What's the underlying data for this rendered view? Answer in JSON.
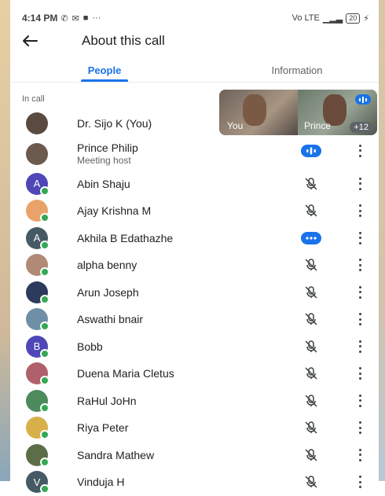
{
  "status_bar": {
    "time": "4:14 PM",
    "overflow": "···",
    "network": "Vo LTE",
    "battery": "20"
  },
  "app_bar": {
    "title": "About this call"
  },
  "tabs": [
    {
      "label": "People",
      "active": true
    },
    {
      "label": "Information",
      "active": false
    }
  ],
  "section_label": "In call",
  "tiles": {
    "you_label": "You",
    "prince_label": "Prince",
    "more_count": "+12"
  },
  "participants": [
    {
      "name": "Dr. Sijo K (You)",
      "subtitle": "",
      "avatar": "photo",
      "avatar_color": "#5a4a3f",
      "mic": "none"
    },
    {
      "name": "Prince Philip",
      "subtitle": "Meeting host",
      "avatar": "photo",
      "avatar_color": "#6b5a4d",
      "mic": "speaking"
    },
    {
      "name": "Abin Shaju",
      "subtitle": "",
      "avatar": "letter",
      "letter": "A",
      "avatar_color": "#4f46b8",
      "mic": "muted"
    },
    {
      "name": "Ajay Krishna M",
      "subtitle": "",
      "avatar": "photo",
      "avatar_color": "#e9a36a",
      "mic": "muted"
    },
    {
      "name": "Akhila B Edathazhe",
      "subtitle": "",
      "avatar": "letter",
      "letter": "A",
      "avatar_color": "#455a64",
      "mic": "connecting"
    },
    {
      "name": "alpha benny",
      "subtitle": "",
      "avatar": "photo",
      "avatar_color": "#b08a77",
      "mic": "muted"
    },
    {
      "name": "Arun Joseph",
      "subtitle": "",
      "avatar": "photo",
      "avatar_color": "#2c3a5c",
      "mic": "muted"
    },
    {
      "name": "Aswathi bnair",
      "subtitle": "",
      "avatar": "photo",
      "avatar_color": "#6f8fa6",
      "mic": "muted"
    },
    {
      "name": "Bobb",
      "subtitle": "",
      "avatar": "letter",
      "letter": "B",
      "avatar_color": "#4f46b8",
      "mic": "muted"
    },
    {
      "name": "Duena Maria Cletus",
      "subtitle": "",
      "avatar": "photo",
      "avatar_color": "#b0606a",
      "mic": "muted"
    },
    {
      "name": "RaHul JoHn",
      "subtitle": "",
      "avatar": "photo",
      "avatar_color": "#4d8a5c",
      "mic": "muted"
    },
    {
      "name": "Riya Peter",
      "subtitle": "",
      "avatar": "photo",
      "avatar_color": "#d8b04a",
      "mic": "muted"
    },
    {
      "name": "Sandra Mathew",
      "subtitle": "",
      "avatar": "photo",
      "avatar_color": "#5b6e48",
      "mic": "muted"
    },
    {
      "name": "Vinduja H",
      "subtitle": "",
      "avatar": "letter",
      "letter": "V",
      "avatar_color": "#455a64",
      "mic": "muted"
    }
  ],
  "colors": {
    "accent": "#1a73e8",
    "online": "#34a853"
  }
}
